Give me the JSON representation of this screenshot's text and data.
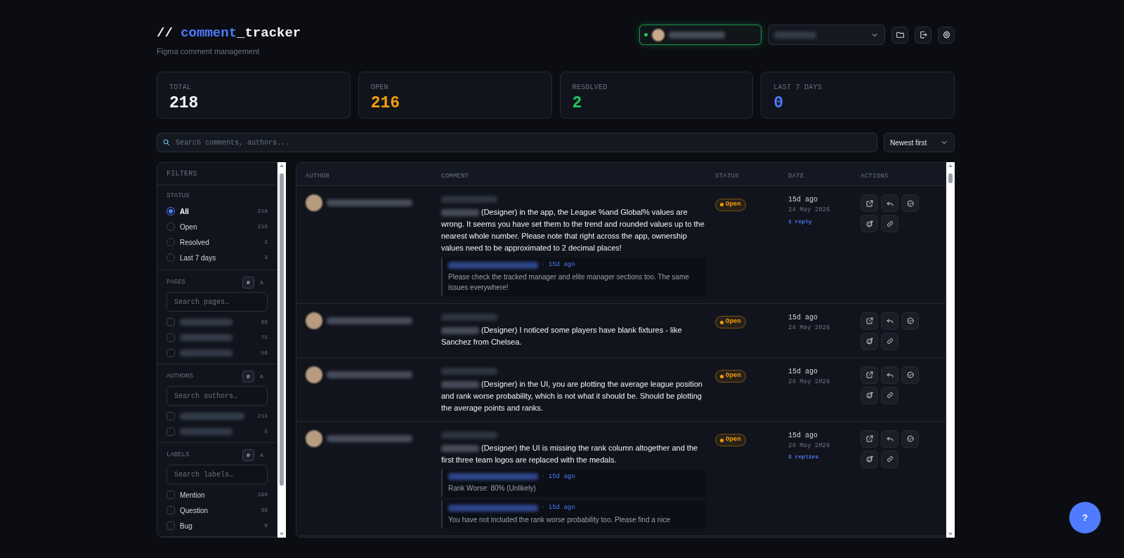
{
  "header": {
    "title_prefix": "// ",
    "title_highlight": "comment",
    "title_rest": "_tracker",
    "subtitle": "Figma comment management"
  },
  "stats": [
    {
      "label": "TOTAL",
      "value": "218",
      "color": "#f3f4f6"
    },
    {
      "label": "OPEN",
      "value": "216",
      "color": "#f59e0b"
    },
    {
      "label": "RESOLVED",
      "value": "2",
      "color": "#22c55e"
    },
    {
      "label": "LAST 7 DAYS",
      "value": "0",
      "color": "#4f7cff"
    }
  ],
  "search": {
    "placeholder": "Search comments, authors..."
  },
  "sort": {
    "value": "Newest first"
  },
  "filters": {
    "title": "FILTERS",
    "status": {
      "heading": "STATUS",
      "options": [
        {
          "label": "All",
          "count": "218",
          "selected": true
        },
        {
          "label": "Open",
          "count": "216",
          "selected": false
        },
        {
          "label": "Resolved",
          "count": "2",
          "selected": false
        },
        {
          "label": "Last 7 days",
          "count": "3",
          "selected": false
        }
      ]
    },
    "sections": [
      {
        "heading": "PAGES",
        "toggle": [
          {
            "label": "#",
            "selected": true
          },
          {
            "label": "A",
            "selected": false
          }
        ],
        "placeholder": "Search pages…",
        "items": [
          {
            "count": "86",
            "checked": false
          },
          {
            "count": "75",
            "checked": false
          },
          {
            "count": "56",
            "checked": false
          }
        ]
      },
      {
        "heading": "AUTHORS",
        "toggle": [
          {
            "label": "#",
            "selected": true
          },
          {
            "label": "A",
            "selected": false
          }
        ],
        "placeholder": "Search authors…",
        "items": [
          {
            "count": "213",
            "checked": false
          },
          {
            "count": "5",
            "checked": false
          }
        ]
      },
      {
        "heading": "LABELS",
        "toggle": [
          {
            "label": "#",
            "selected": true
          },
          {
            "label": "A",
            "selected": false
          }
        ],
        "placeholder": "Search labels…",
        "items": [
          {
            "label": "Mention",
            "count": "199",
            "checked": false
          },
          {
            "label": "Question",
            "count": "36",
            "checked": false
          },
          {
            "label": "Bug",
            "count": "9",
            "checked": false
          }
        ]
      }
    ]
  },
  "table": {
    "columns": [
      "AUTHOR",
      "COMMENT",
      "STATUS",
      "DATE",
      "ACTIONS"
    ],
    "rows": [
      {
        "comment": "(Designer) in the app, the League %and Global% values are wrong. It seems you have set them to the trend and rounded values up to the nearest whole number. Please note that right across the app, ownership values need to be approximated to 2 decimal places!",
        "status": {
          "label": "Open",
          "kind": "open"
        },
        "time": "15d ago",
        "date": "24 May 2026",
        "replies_link": "1 reply",
        "replies": [
          {
            "time": "· 15d ago",
            "text": "Please check the tracked manager and elite manager sections too. The same issues everywhere!"
          }
        ]
      },
      {
        "comment": "(Designer) I noticed some players have blank fixtures - like Sanchez from Chelsea.",
        "status": {
          "label": "Open",
          "kind": "open"
        },
        "time": "15d ago",
        "date": "24 May 2026",
        "replies": []
      },
      {
        "comment": "(Designer) in the UI, you are plotting the average league position and rank worse probability, which is not what it should be. Should be plotting the average points and ranks.",
        "status": {
          "label": "Open",
          "kind": "open"
        },
        "time": "15d ago",
        "date": "24 May 2026",
        "replies": []
      },
      {
        "comment": "(Designer) the UI is missing the rank column altogether and the first three team logos are replaced with the medals.",
        "status": {
          "label": "Open",
          "kind": "open"
        },
        "time": "15d ago",
        "date": "24 May 2026",
        "replies_link": "3 replies",
        "replies": [
          {
            "time": "· 15d ago",
            "text": "Rank Worse: 80% (Unlikely)"
          },
          {
            "time": "· 15d ago",
            "text": "You have not included the rank worse probability too. Please find a nice"
          }
        ]
      }
    ]
  },
  "help": {
    "label": "?"
  }
}
